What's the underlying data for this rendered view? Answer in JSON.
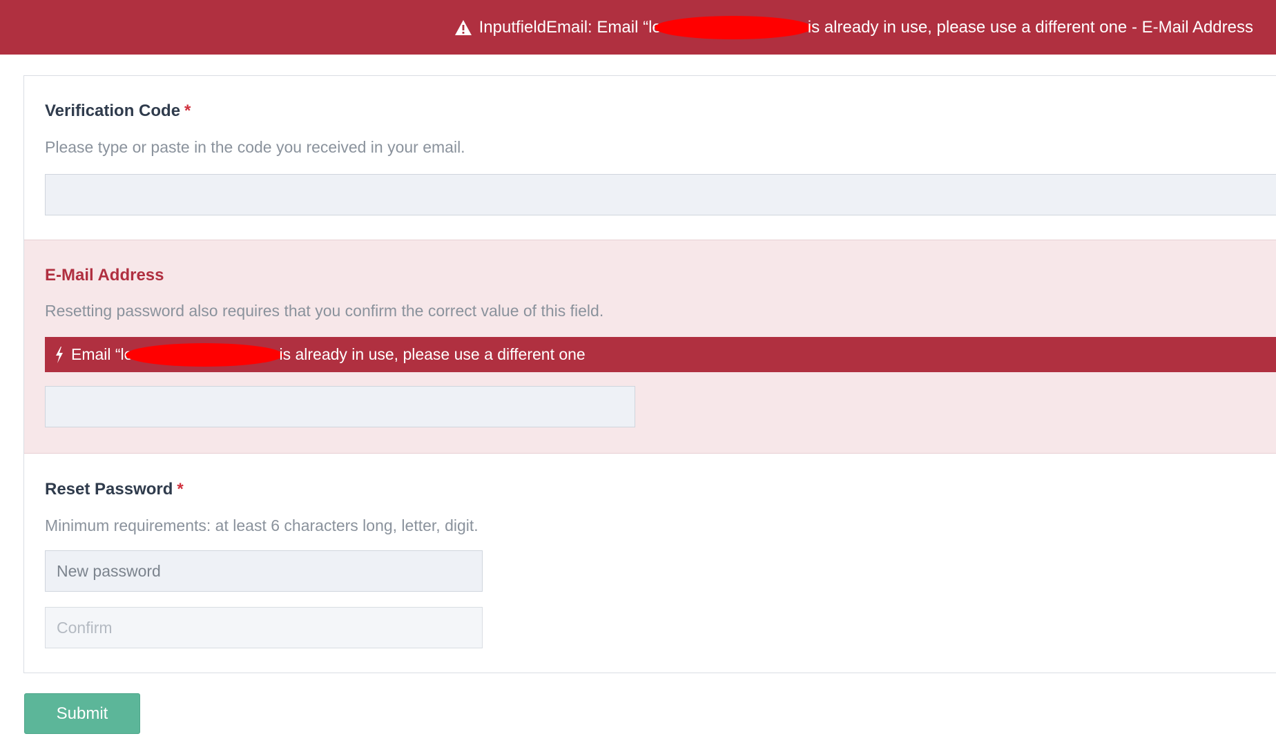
{
  "banner": {
    "prefix": "InputfieldEmail: Email “le",
    "suffix": "is already in use, please use a different one - E-Mail Address",
    "icon": "warning-icon",
    "color": "#b03040"
  },
  "verification_code": {
    "label": "Verification Code",
    "required_marker": "*",
    "help": "Please type or paste in the code you received in your email.",
    "value": ""
  },
  "email": {
    "label": "E-Mail Address",
    "help": "Resetting password also requires that you confirm the correct value of this field.",
    "error_prefix": "Email “le",
    "error_suffix": "is already in use, please use a different one",
    "error_icon": "bolt-icon",
    "value": ""
  },
  "reset_password": {
    "label": "Reset Password",
    "required_marker": "*",
    "help": "Minimum requirements: at least 6 characters long, letter, digit.",
    "new_placeholder": "New password",
    "confirm_placeholder": "Confirm"
  },
  "submit": {
    "label": "Submit",
    "color": "#5cb699"
  }
}
